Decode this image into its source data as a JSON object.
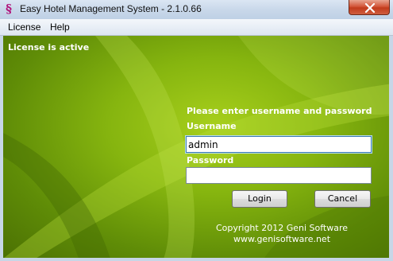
{
  "window": {
    "title": "Easy Hotel Management System - 2.1.0.66",
    "app_icon": "geni-logo-icon",
    "close_icon": "close-icon"
  },
  "menu": {
    "items": [
      {
        "label": "License"
      },
      {
        "label": "Help"
      }
    ]
  },
  "status": {
    "license_text": "License is active"
  },
  "login": {
    "prompt": "Please enter username and password",
    "username_label": "Username",
    "username_value": "admin",
    "password_label": "Password",
    "password_value": "",
    "login_button": "Login",
    "cancel_button": "Cancel"
  },
  "footer": {
    "copyright": "Copyright 2012  Geni Software",
    "website": "www.genisoftware.net"
  },
  "colors": {
    "background_green": "#86b50f",
    "text_white": "#ffffff",
    "close_red": "#c13b1c"
  }
}
